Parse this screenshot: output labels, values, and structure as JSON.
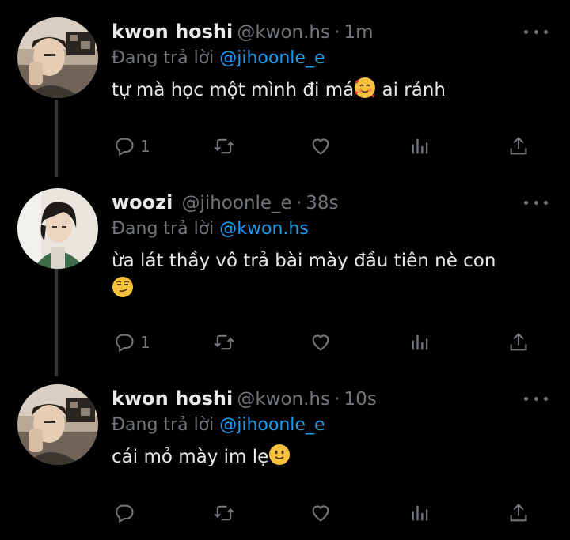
{
  "tweets": [
    {
      "name": "kwon hoshi",
      "handle": "@kwon.hs",
      "time": "1m",
      "reply_prefix": "Đang trả lời",
      "reply_mention": "@jihoonle_e",
      "text_before_emoji": "tự mà học một mình đi má",
      "emoji": "smiling-face-with-hearts",
      "text_after_emoji": " ai rảnh",
      "reply_count": "1"
    },
    {
      "name": "woozi",
      "handle": "@jihoonle_e",
      "time": "38s",
      "reply_prefix": "Đang trả lời",
      "reply_mention": "@kwon.hs",
      "text_before_emoji": "ừa lát thầy vô trả bài mày đầu tiên nè con",
      "emoji": "smirking-face",
      "text_after_emoji": "",
      "reply_count": "1"
    },
    {
      "name": "kwon hoshi",
      "handle": "@kwon.hs",
      "time": "10s",
      "reply_prefix": "Đang trả lời",
      "reply_mention": "@jihoonle_e",
      "text_before_emoji": "cái mỏ mày im lẹ",
      "emoji": "slightly-smiling-face",
      "text_after_emoji": "",
      "reply_count": ""
    }
  ],
  "separator": "·",
  "colors": {
    "background": "#000000",
    "text": "#e7e9ea",
    "secondary": "#71767b",
    "link": "#1d9bf0",
    "thread_line": "#333639"
  },
  "icons": [
    "reply-icon",
    "retweet-icon",
    "like-icon",
    "views-icon",
    "share-icon",
    "more-icon"
  ]
}
